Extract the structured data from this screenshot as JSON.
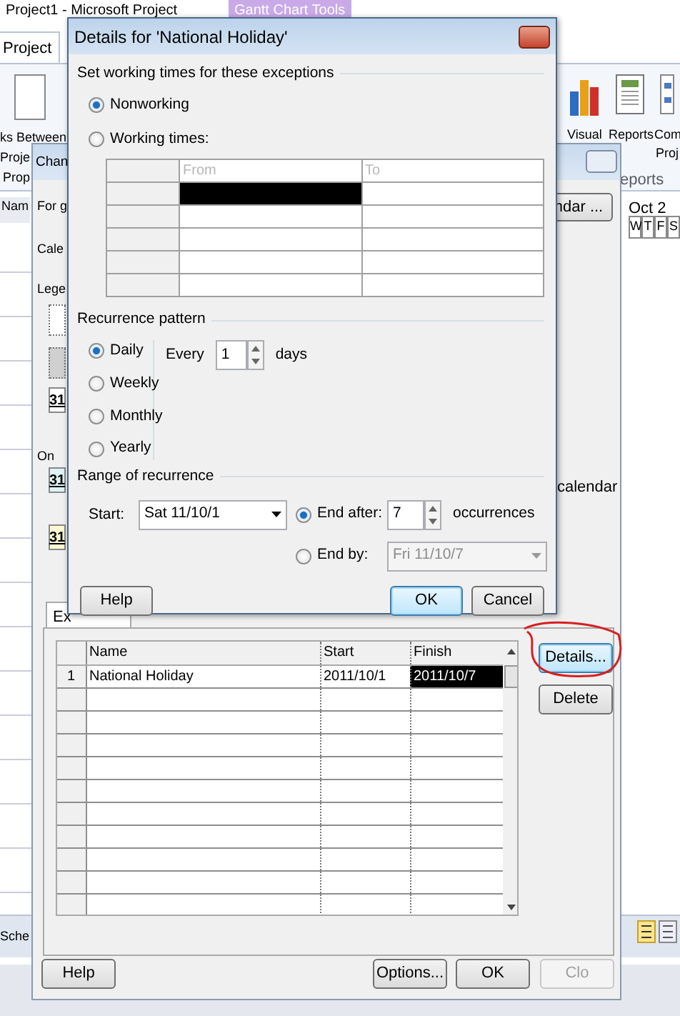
{
  "app": {
    "title": "Project1 - Microsoft Project",
    "context_tab": "Gantt Chart Tools",
    "tabs": [
      {
        "label": "Project",
        "selected": true
      }
    ],
    "ribbon_left": [
      "ks Between",
      "Proje",
      "Prop"
    ],
    "ribbon_right": {
      "buttons": [
        "Visual",
        "Reports",
        "Com"
      ],
      "second_line": "Proj",
      "group": "eports"
    },
    "sheet_header": "Nam",
    "gantt": {
      "week": "Oct 2",
      "days": [
        "W",
        "T",
        "F",
        "S"
      ]
    },
    "view_label": "Sche"
  },
  "change_working_time": {
    "title": "Chan",
    "labels": [
      "For g",
      "Cale",
      "Lege",
      "On"
    ],
    "calendar_button": "ndar ...",
    "calendar_text": "calendar",
    "legend": [
      {
        "text": "31",
        "color": "#ffffff"
      },
      {
        "text": "31",
        "color": "#dff3f7"
      },
      {
        "text": "31",
        "color": "#fbf8d2"
      }
    ],
    "tab": "Ex",
    "table": {
      "columns": [
        "Name",
        "Start",
        "Finish"
      ],
      "rows": [
        {
          "number": "1",
          "cells": [
            {
              "text": "National Holiday",
              "selected": false
            },
            {
              "text": "2011/10/1",
              "selected": false
            },
            {
              "text": "2011/10/7",
              "selected": true
            }
          ]
        }
      ]
    },
    "side_buttons": [
      {
        "label": "Details...",
        "focused": true
      },
      {
        "label": "Delete",
        "focused": false
      }
    ],
    "footer_buttons": [
      {
        "label": "Help",
        "disabled": false
      },
      {
        "label": "Options...",
        "disabled": false
      },
      {
        "label": "OK",
        "disabled": false
      },
      {
        "label": "Clo",
        "disabled": true
      }
    ]
  },
  "details": {
    "title": "Details for 'National Holiday'",
    "working_section": "Set working times for these exceptions",
    "mode_options": [
      {
        "label": "Nonworking",
        "selected": true
      },
      {
        "label": "Working times:",
        "selected": false
      }
    ],
    "times_table": {
      "columns": [
        "From",
        "To"
      ],
      "disabled": true
    },
    "recurrence_title": "Recurrence pattern",
    "patterns": [
      {
        "label": "Daily",
        "selected": true
      },
      {
        "label": "Weekly",
        "selected": false
      },
      {
        "label": "Monthly",
        "selected": false
      },
      {
        "label": "Yearly",
        "selected": false
      }
    ],
    "every_label": "Every",
    "every_value": "1",
    "every_unit": "days",
    "range_title": "Range of recurrence",
    "start_label": "Start:",
    "start_value": "Sat 11/10/1",
    "end_options": [
      {
        "label": "End after:",
        "selected": true,
        "value": "7",
        "unit": "occurrences"
      },
      {
        "label": "End by:",
        "selected": false,
        "value": "Fri 11/10/7"
      }
    ],
    "buttons": [
      {
        "label": "Help",
        "default": false
      },
      {
        "label": "OK",
        "default": true
      },
      {
        "label": "Cancel",
        "default": false
      }
    ]
  }
}
